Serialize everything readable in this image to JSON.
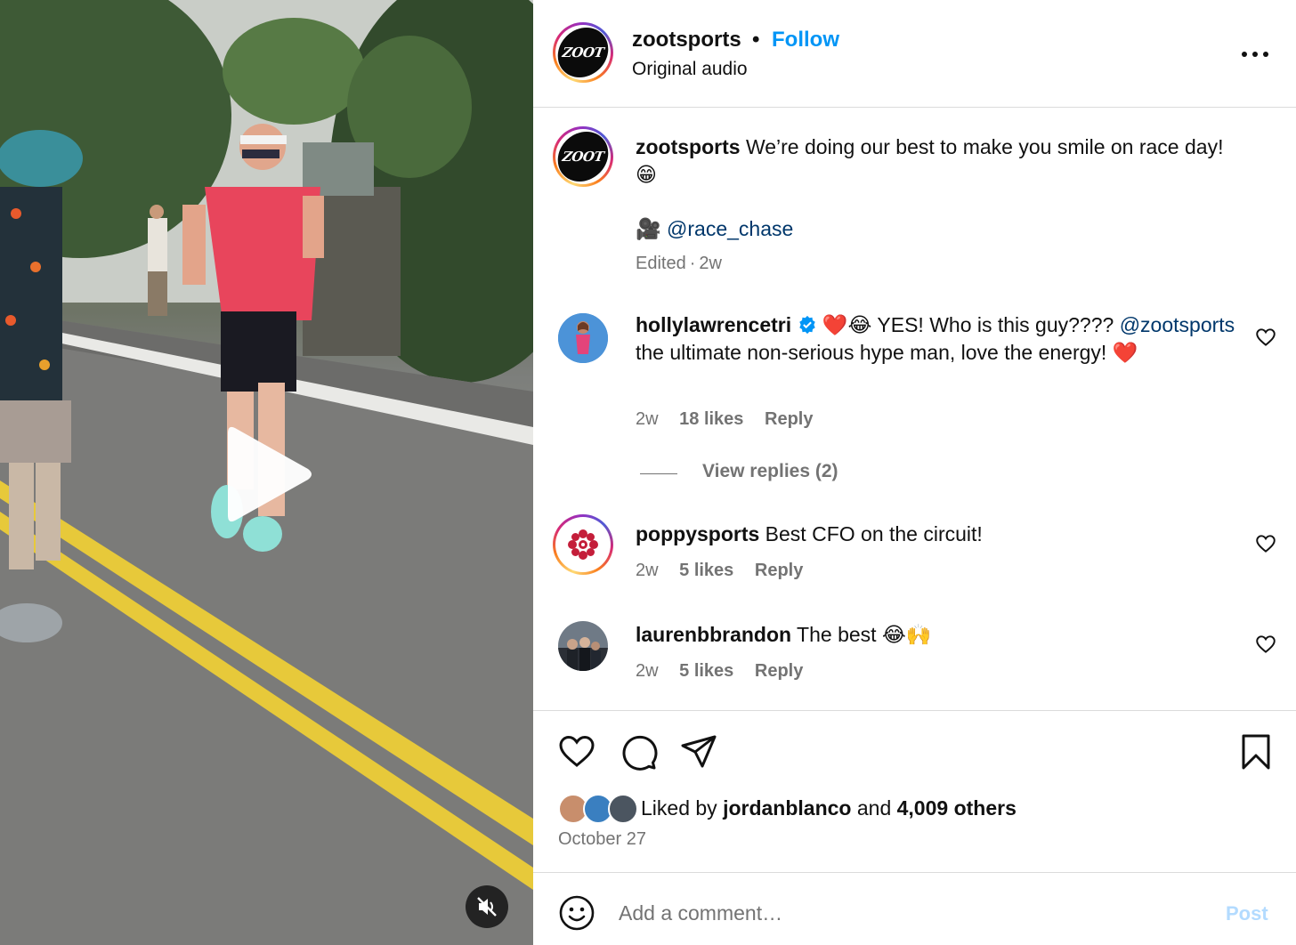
{
  "video": {
    "play_icon": "play-icon",
    "mute_icon": "muted-speaker-icon"
  },
  "header": {
    "username": "zootsports",
    "separator": "•",
    "follow_label": "Follow",
    "audio": "Original audio",
    "avatar_text": "ZOOT",
    "more_icon": "more-options-icon"
  },
  "caption": {
    "username": "zootsports",
    "text": "We’re doing our best to make you smile on race day! 😁",
    "credit_icon": "🎥",
    "credit_mention": "@race_chase",
    "edited": "Edited",
    "time": "2w"
  },
  "comments": [
    {
      "username": "hollylawrencetri",
      "verified": true,
      "text_pre": "❤️😂 YES! Who is this guy????",
      "mention": "@zootsports",
      "text_post": "the ultimate non-serious hype man, love the energy! ❤️",
      "time": "2w",
      "likes": "18 likes",
      "reply": "Reply",
      "view_replies": "View replies (2)"
    },
    {
      "username": "poppysports",
      "text": "Best CFO on the circuit!",
      "time": "2w",
      "likes": "5 likes",
      "reply": "Reply"
    },
    {
      "username": "laurenbbrandon",
      "text": "The best 😂🙌",
      "time": "2w",
      "likes": "5 likes",
      "reply": "Reply"
    }
  ],
  "actions": {
    "like_icon": "heart-icon",
    "comment_icon": "comment-icon",
    "share_icon": "share-icon",
    "save_icon": "bookmark-icon",
    "liked_prefix": "Liked by",
    "liked_user": "jordanblanco",
    "liked_and": "and",
    "liked_others": "4,009 others",
    "date": "October 27"
  },
  "compose": {
    "placeholder": "Add a comment…",
    "post_label": "Post",
    "emoji_icon": "smiley-icon"
  },
  "colors": {
    "link_blue": "#0095f6",
    "mention_blue": "#00376b",
    "secondary_text": "#737373",
    "post_disabled": "#b3dbff",
    "verified_blue": "#0095f6"
  }
}
